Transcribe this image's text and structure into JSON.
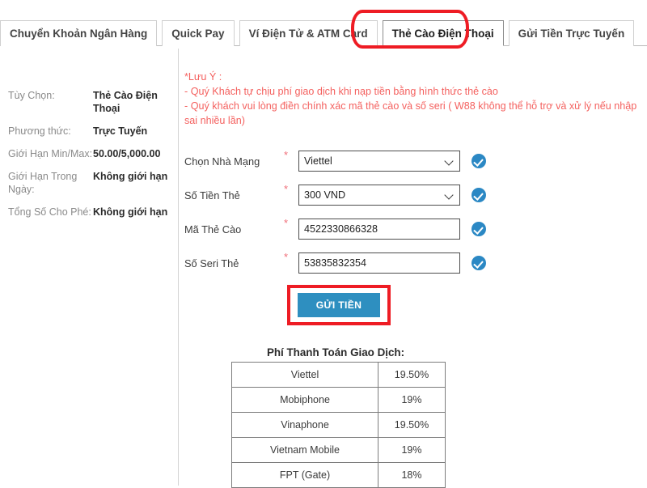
{
  "tabs": [
    {
      "label": "Chuyển Khoản Ngân Hàng",
      "active": false
    },
    {
      "label": "Quick Pay",
      "active": false
    },
    {
      "label": "Ví Điện Tử & ATM Card",
      "active": false
    },
    {
      "label": "Thẻ Cào Điện Thoại",
      "active": true
    },
    {
      "label": "Gửi Tiền Trực Tuyến",
      "active": false
    }
  ],
  "summary": [
    {
      "label": "Tùy Chọn:",
      "value": "Thẻ Cào Điện Thoại"
    },
    {
      "label": "Phương thức:",
      "value": "Trực Tuyến"
    },
    {
      "label": "Giới Hạn Min/Max:",
      "value": "50.00/5,000.00"
    },
    {
      "label": "Giới Hạn Trong Ngày:",
      "value": "Không giới hạn"
    },
    {
      "label": "Tổng Số Cho Phé:",
      "value": "Không giới hạn"
    }
  ],
  "notice": {
    "line1": "*Lưu Ý :",
    "line2": "- Quý Khách tự chịu phí giao dịch khi nạp tiền bằng hình thức thẻ cào",
    "line3": "- Quý khách vui lòng điền chính xác mã thẻ cào và số seri ( W88 không thể hỗ trợ và xử lý nếu nhập sai nhiều lần)"
  },
  "form": {
    "required_mark": "*",
    "fields": [
      {
        "label": "Chọn Nhà Mạng",
        "value": "Viettel",
        "type": "select",
        "valid": true
      },
      {
        "label": "Số Tiền Thẻ",
        "value": "300 VND",
        "type": "select",
        "valid": true
      },
      {
        "label": "Mã Thẻ Cào",
        "value": "4522330866328",
        "type": "text",
        "valid": true
      },
      {
        "label": "Số Seri Thẻ",
        "value": "53835832354",
        "type": "text",
        "valid": true
      }
    ],
    "submit_label": "GỬI TIỀN"
  },
  "fee_table": {
    "title": "Phí Thanh Toán Giao Dịch:",
    "rows": [
      {
        "name": "Viettel",
        "fee": "19.50%"
      },
      {
        "name": "Mobiphone",
        "fee": "19%"
      },
      {
        "name": "Vinaphone",
        "fee": "19.50%"
      },
      {
        "name": "Vietnam Mobile",
        "fee": "19%"
      },
      {
        "name": "FPT (Gate)",
        "fee": "18%"
      }
    ]
  },
  "colors": {
    "accent_blue": "#2e8fc0",
    "check_blue": "#2b88c4",
    "notice_red": "#f4615f",
    "annotation_red": "#ee1c24"
  }
}
